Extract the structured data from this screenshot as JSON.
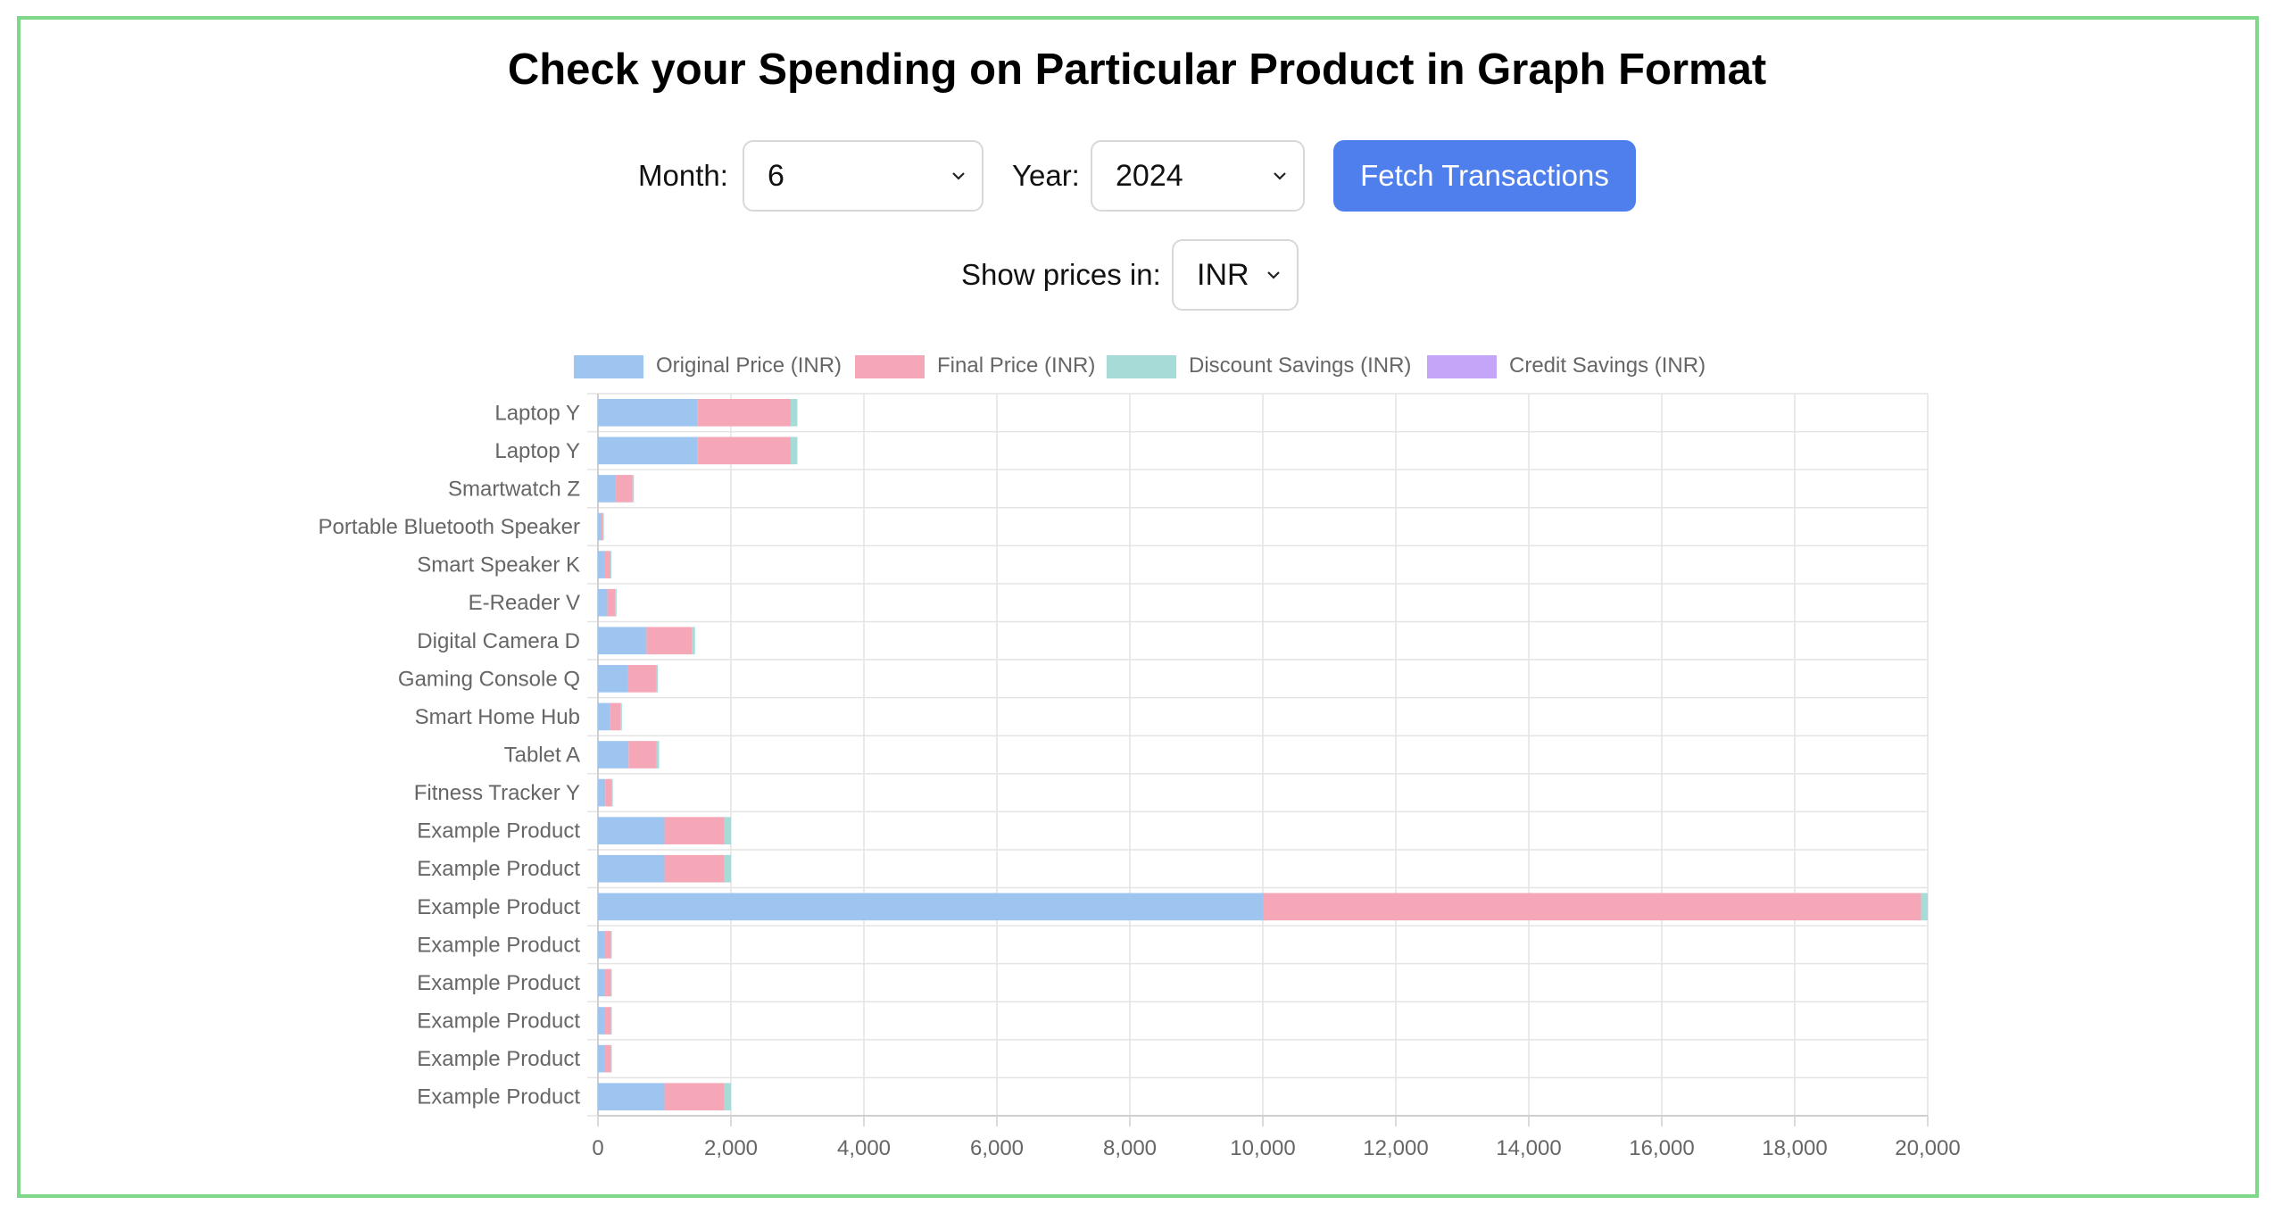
{
  "page": {
    "title": "Check your Spending on Particular Product in Graph Format"
  },
  "controls": {
    "month_label": "Month:",
    "month_value": "6",
    "year_label": "Year:",
    "year_value": "2024",
    "fetch_label": "Fetch Transactions",
    "currency_label": "Show prices in:",
    "currency_value": "INR"
  },
  "colors": {
    "original": "#9ec5f0",
    "final": "#f5a7b8",
    "discount": "#a6dbd8",
    "credit": "#c4a5f7",
    "frame": "#7fd88a",
    "button": "#4f7fec"
  },
  "chart_data": {
    "type": "bar",
    "orientation": "horizontal",
    "stacked": true,
    "categories": [
      "Laptop Y",
      "Laptop Y",
      "Smartwatch Z",
      "Portable Bluetooth Speaker",
      "Smart Speaker K",
      "E-Reader V",
      "Digital Camera D",
      "Gaming Console Q",
      "Smart Home Hub",
      "Tablet A",
      "Fitness Tracker Y",
      "Example Product",
      "Example Product",
      "Example Product",
      "Example Product",
      "Example Product",
      "Example Product",
      "Example Product",
      "Example Product"
    ],
    "series": [
      {
        "name": "Original Price (INR)",
        "color": "#9ec5f0",
        "values": [
          1500,
          1500,
          270,
          40,
          100,
          140,
          730,
          450,
          180,
          460,
          110,
          1000,
          1000,
          10000,
          100,
          100,
          100,
          100,
          1000
        ]
      },
      {
        "name": "Final Price (INR)",
        "color": "#f5a7b8",
        "values": [
          1400,
          1400,
          250,
          35,
          90,
          120,
          680,
          430,
          160,
          420,
          100,
          900,
          900,
          9900,
          95,
          95,
          95,
          95,
          900
        ]
      },
      {
        "name": "Discount Savings (INR)",
        "color": "#a6dbd8",
        "values": [
          100,
          100,
          20,
          5,
          10,
          20,
          50,
          20,
          20,
          40,
          10,
          100,
          100,
          100,
          5,
          5,
          5,
          5,
          100
        ]
      },
      {
        "name": "Credit Savings (INR)",
        "color": "#c4a5f7",
        "values": [
          0,
          0,
          0,
          0,
          0,
          0,
          0,
          0,
          0,
          0,
          0,
          0,
          0,
          0,
          0,
          0,
          0,
          0,
          0
        ]
      }
    ],
    "xlim": [
      0,
      20000
    ],
    "xticks": [
      0,
      2000,
      4000,
      6000,
      8000,
      10000,
      12000,
      14000,
      16000,
      18000,
      20000
    ],
    "xtick_labels": [
      "0",
      "2,000",
      "4,000",
      "6,000",
      "8,000",
      "10,000",
      "12,000",
      "14,000",
      "16,000",
      "18,000",
      "20,000"
    ],
    "grid": true,
    "legend_position": "top"
  }
}
